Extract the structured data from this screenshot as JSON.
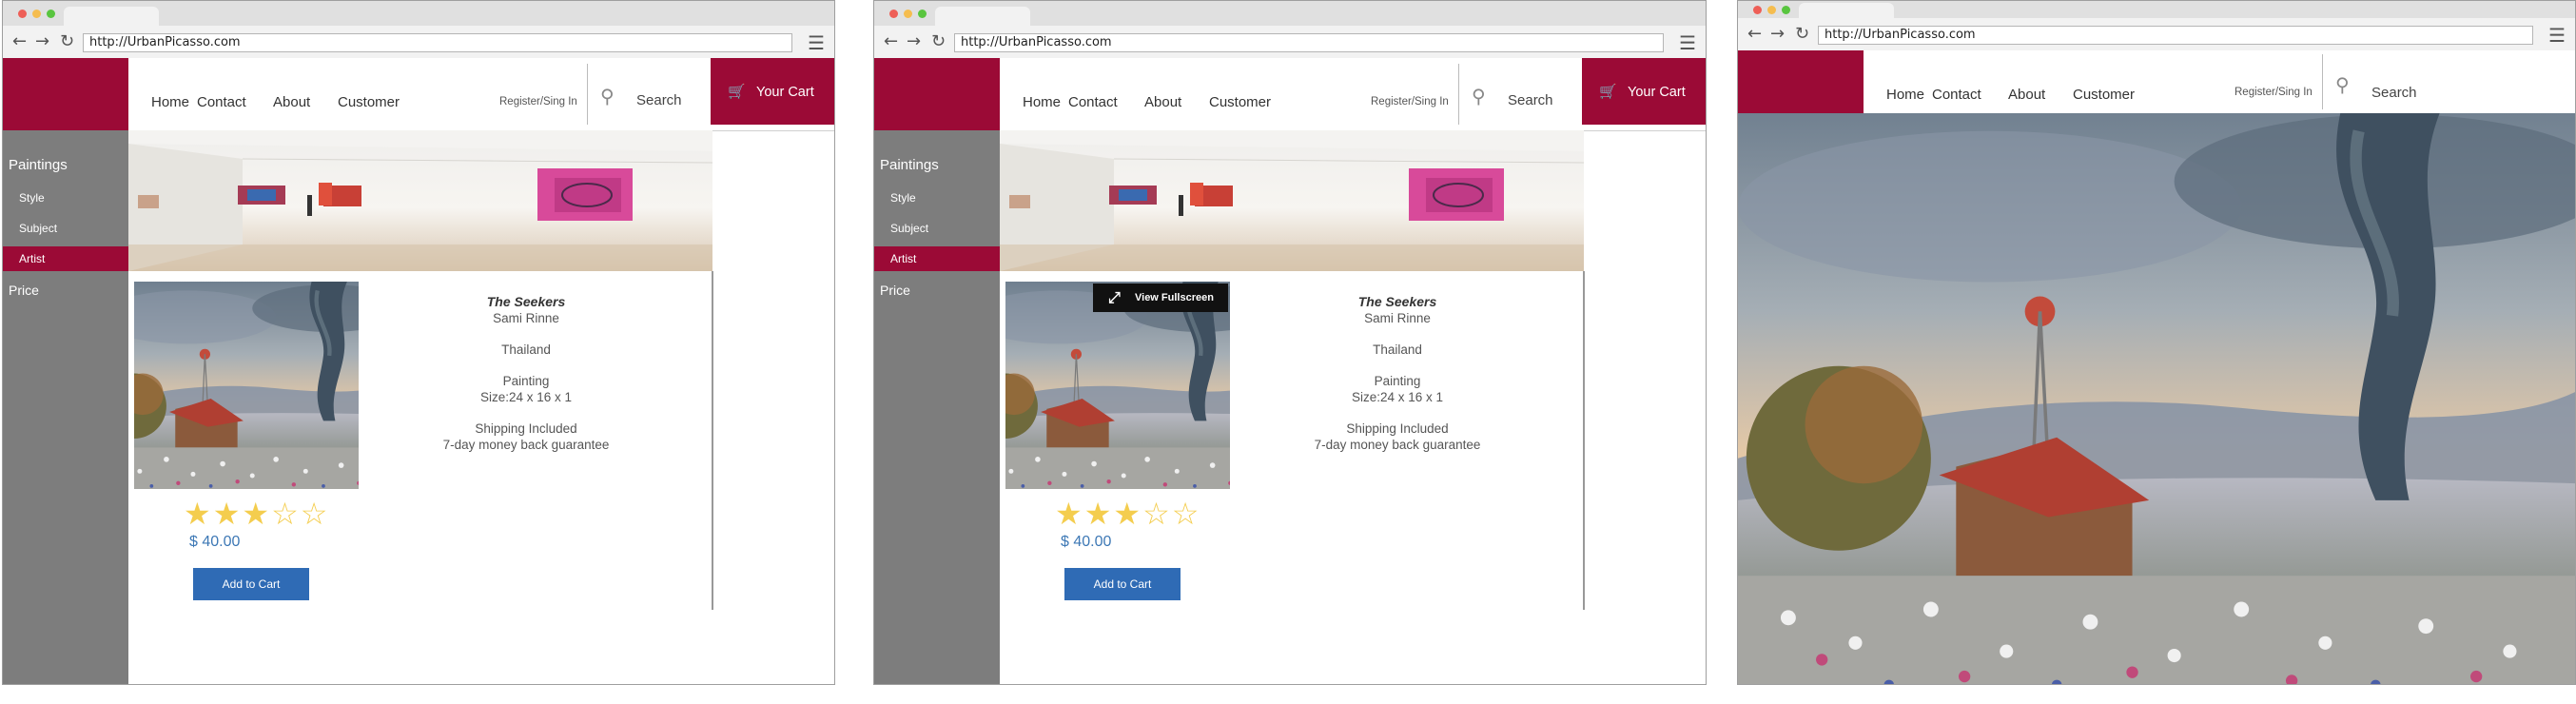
{
  "browser": {
    "url": "http://UrbanPicasso.com",
    "traffic_light_colors": [
      "#ee5f57",
      "#f5bd4f",
      "#59c53f"
    ],
    "back_icon": "back-arrow-icon",
    "forward_icon": "forward-arrow-icon",
    "reload_icon": "reload-icon",
    "menu_icon": "hamburger-menu-icon"
  },
  "nav": {
    "home": "Home",
    "contact": "Contact",
    "about": "About",
    "customer": "Customer",
    "register": "Register/Sing In",
    "search": "Search",
    "cart": "Your Cart"
  },
  "sidebar": {
    "heading": "Paintings",
    "items": [
      {
        "label": "Style"
      },
      {
        "label": "Subject"
      },
      {
        "label": "Artist",
        "active": true
      }
    ],
    "price": "Price"
  },
  "product": {
    "title": "The Seekers",
    "artist": "Sami Rinne",
    "country": "Thailand",
    "medium": "Painting",
    "size": "Size:24 x 16 x 1",
    "shipping": "Shipping Included",
    "guarantee": "7-day money back guarantee",
    "rating": 3,
    "rating_max": 5,
    "price": "$ 40.00",
    "add_to_cart": "Add to Cart"
  },
  "overlay": {
    "view_fullscreen": "View Fullscreen"
  },
  "colors": {
    "brand": "#9b0a36",
    "sidebar": "#7d7d7d",
    "button": "#2f6bb5",
    "price": "#3d78b5",
    "star": "#f4cd4e"
  }
}
